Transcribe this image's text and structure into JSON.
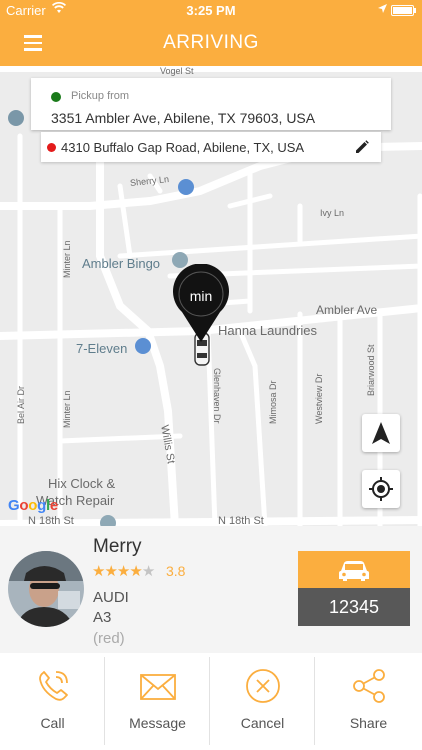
{
  "status": {
    "carrier": "Carrier",
    "time": "3:25 PM"
  },
  "header": {
    "title": "ARRIVING"
  },
  "pickup": {
    "label": "Pickup from",
    "address": "3351 Ambler Ave,  Abilene,  TX 79603,  USA"
  },
  "dropoff": {
    "address": "4310 Buffalo Gap Road, Abilene, TX, USA"
  },
  "map": {
    "labels": {
      "vogel": "Vogel St",
      "sherry": "Sherry Ln",
      "ivy": "Ivy Ln",
      "ambler_bingo": "Ambler Bingo",
      "ambler_ave": "Ambler Ave",
      "hanna": "Hanna Laundries",
      "seven_eleven": "7-Eleven",
      "minter1": "Minter Ln",
      "minter2": "Minter Ln",
      "belair": "Bel Air Dr",
      "willis": "Willis St",
      "glenhaven": "Glenhaven Dr",
      "mimosa": "Mimosa Dr",
      "westview": "Westview Dr",
      "briarwood": "Briarwood St",
      "hix": "Hix Clock &",
      "watch": "Watch Repair",
      "n18a": "N 18th St",
      "n18b": "N 18th St"
    },
    "eta_unit": "min",
    "google": [
      "G",
      "o",
      "o",
      "g",
      "l",
      "e"
    ],
    "google_colors": [
      "#4285f4",
      "#ea4335",
      "#fbbc05",
      "#4285f4",
      "#34a853",
      "#ea4335"
    ]
  },
  "driver": {
    "name": "Merry",
    "stars": 4,
    "rating": "3.8",
    "make": "AUDI",
    "model": "A3",
    "color": "(red)",
    "plate": "12345"
  },
  "actions": [
    {
      "label": "Call",
      "icon": "phone-icon"
    },
    {
      "label": "Message",
      "icon": "envelope-icon"
    },
    {
      "label": "Cancel",
      "icon": "cancel-icon"
    },
    {
      "label": "Share",
      "icon": "share-icon"
    }
  ],
  "colors": {
    "accent": "#fbae3f",
    "plate_bg": "#585858",
    "pickup_dot": "#1a7a1a",
    "dropoff_dot": "#e31b1b"
  }
}
